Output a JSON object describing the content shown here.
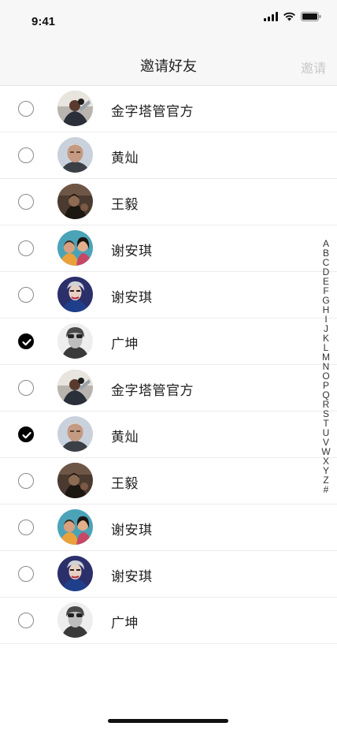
{
  "status": {
    "time": "9:41"
  },
  "nav": {
    "title": "邀请好友",
    "action": "邀请"
  },
  "contacts": [
    {
      "name": "金字塔管官方",
      "checked": false,
      "avatar": "a1"
    },
    {
      "name": "黄灿",
      "checked": false,
      "avatar": "a2"
    },
    {
      "name": "王毅",
      "checked": false,
      "avatar": "a3"
    },
    {
      "name": "谢安琪",
      "checked": false,
      "avatar": "a4"
    },
    {
      "name": "谢安琪",
      "checked": false,
      "avatar": "a5"
    },
    {
      "name": "广坤",
      "checked": true,
      "avatar": "a6"
    },
    {
      "name": "金字塔管官方",
      "checked": false,
      "avatar": "a1"
    },
    {
      "name": "黄灿",
      "checked": true,
      "avatar": "a2"
    },
    {
      "name": "王毅",
      "checked": false,
      "avatar": "a3"
    },
    {
      "name": "谢安琪",
      "checked": false,
      "avatar": "a4"
    },
    {
      "name": "谢安琪",
      "checked": false,
      "avatar": "a5"
    },
    {
      "name": "广坤",
      "checked": false,
      "avatar": "a6"
    }
  ],
  "alphabet": [
    "A",
    "B",
    "C",
    "D",
    "E",
    "F",
    "G",
    "H",
    "I",
    "J",
    "K",
    "L",
    "M",
    "N",
    "O",
    "P",
    "Q",
    "R",
    "S",
    "T",
    "U",
    "V",
    "W",
    "X",
    "Y",
    "Z",
    "#"
  ]
}
